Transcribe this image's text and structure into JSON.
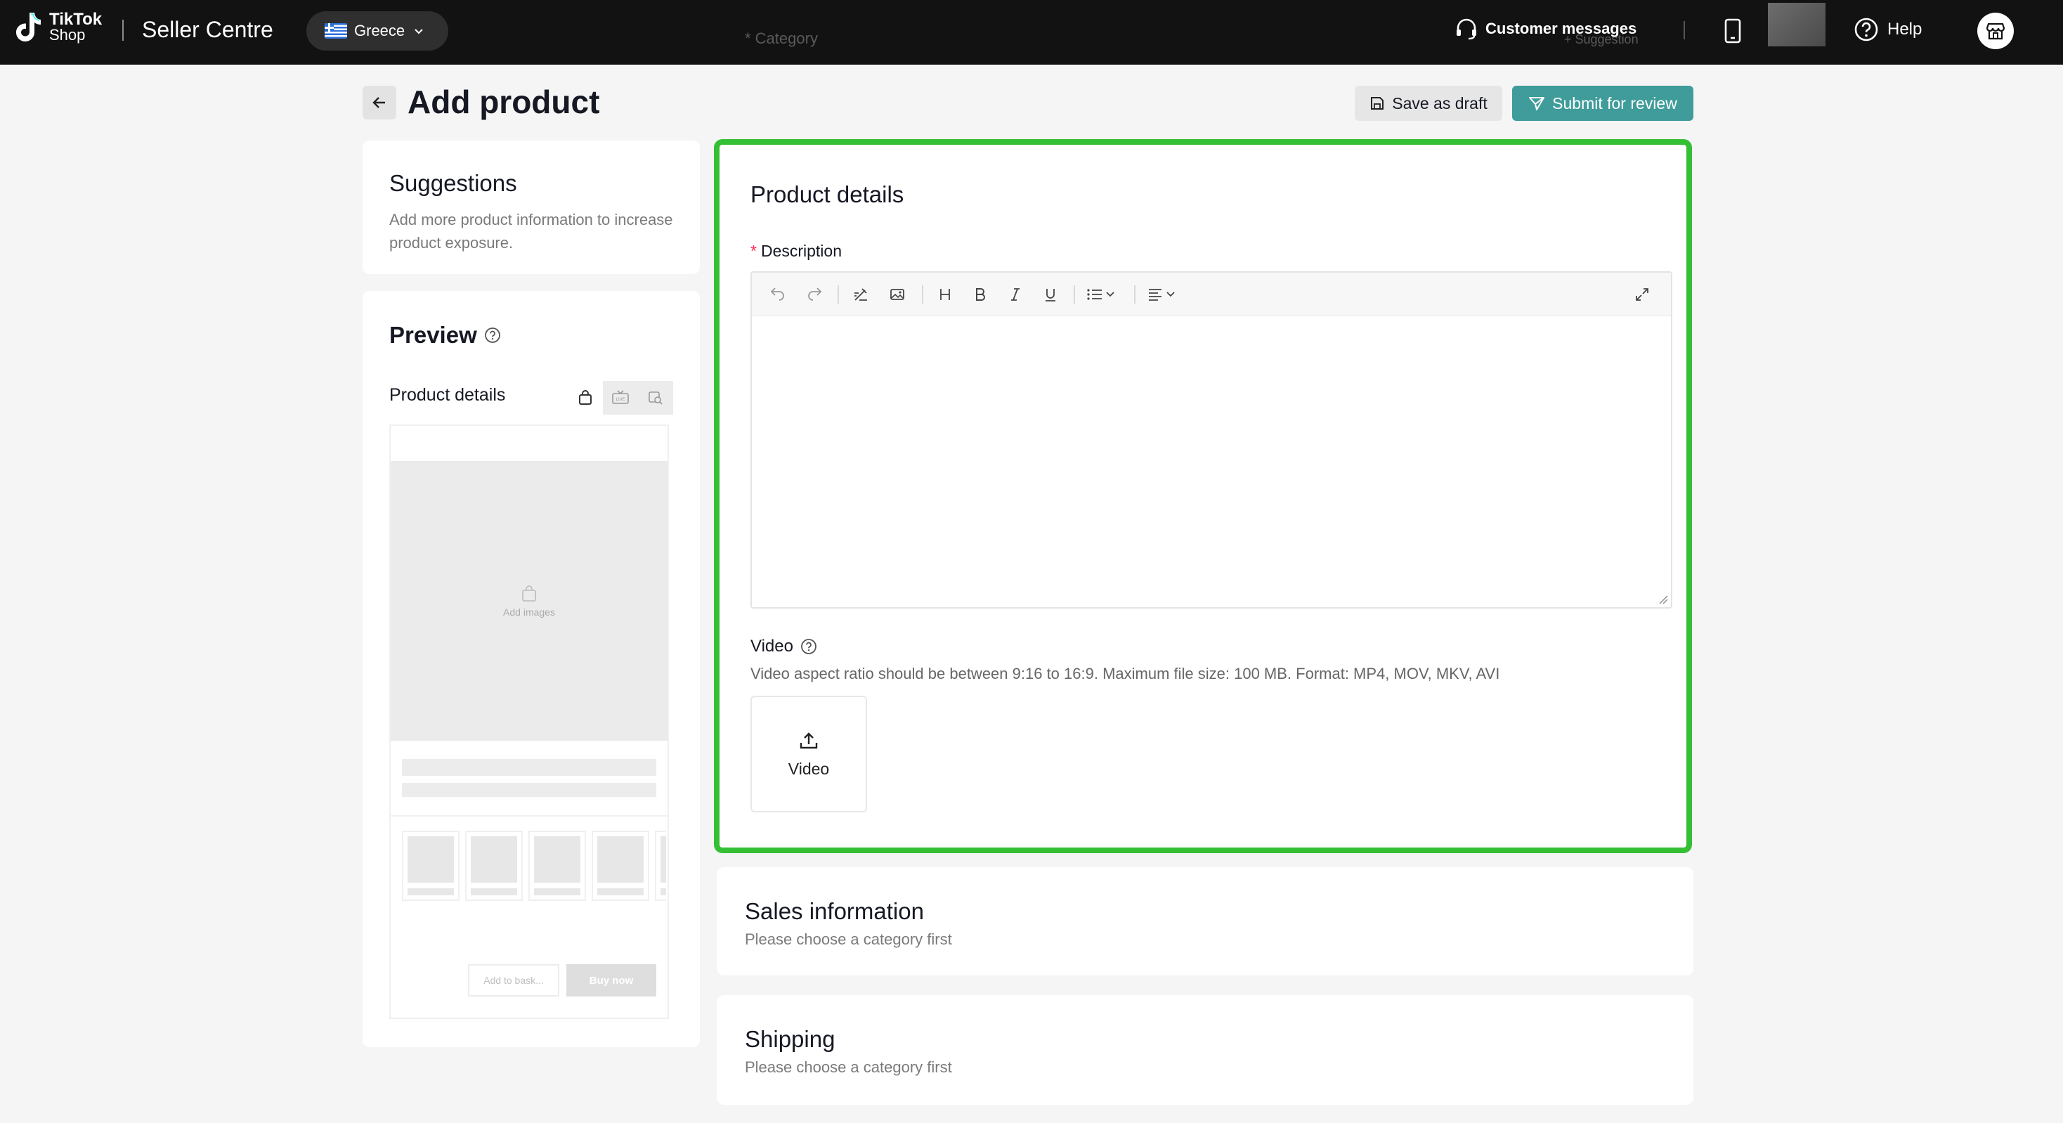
{
  "topbar": {
    "logo_line1": "TikTok",
    "logo_line2": "Shop",
    "app_title": "Seller Centre",
    "region": "Greece",
    "ghost_category": "* Category",
    "ghost_suggestion": "+ Suggestion",
    "customer_messages": "Customer messages",
    "help": "Help"
  },
  "header": {
    "title": "Add product",
    "save_draft": "Save as draft",
    "submit": "Submit for review"
  },
  "suggestions": {
    "title": "Suggestions",
    "text": "Add more product information to increase product exposure."
  },
  "preview": {
    "title": "Preview",
    "product_details": "Product details",
    "add_images": "Add images",
    "add_to_basket": "Add to bask...",
    "buy_now": "Buy now"
  },
  "product_details": {
    "title": "Product details",
    "description_label": "Description",
    "video_label": "Video",
    "video_hint": "Video aspect ratio should be between 9:16 to 16:9. Maximum file size: 100 MB. Format: MP4, MOV, MKV, AVI",
    "upload_label": "Video"
  },
  "sales": {
    "title": "Sales information",
    "subtitle": "Please choose a category first"
  },
  "shipping": {
    "title": "Shipping",
    "subtitle": "Please choose a category first"
  },
  "colors": {
    "accent": "#3f9c9a",
    "highlight": "#35bf34",
    "required": "#fe2c55"
  }
}
